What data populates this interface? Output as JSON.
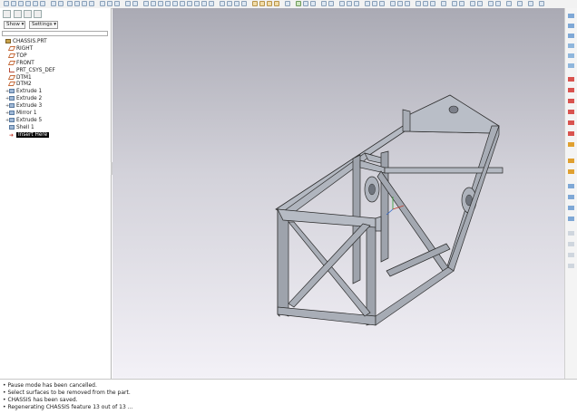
{
  "navigator": {
    "show_label": "Show ▾",
    "settings_label": "Settings ▾",
    "filter_value": "",
    "tree": [
      {
        "label": "CHASSIS.PRT",
        "icon": "part-icon",
        "expand": ""
      },
      {
        "label": "RIGHT",
        "icon": "datum-plane-icon",
        "expand": ""
      },
      {
        "label": "TOP",
        "icon": "datum-plane-icon",
        "expand": ""
      },
      {
        "label": "FRONT",
        "icon": "datum-plane-icon",
        "expand": ""
      },
      {
        "label": "PRT_CSYS_DEF",
        "icon": "csys-icon",
        "expand": ""
      },
      {
        "label": "DTM1",
        "icon": "datum-plane-icon",
        "expand": ""
      },
      {
        "label": "DTM2",
        "icon": "datum-plane-icon",
        "expand": ""
      },
      {
        "label": "Extrude 1",
        "icon": "extrude-icon",
        "expand": "+"
      },
      {
        "label": "Extrude 2",
        "icon": "extrude-icon",
        "expand": "+"
      },
      {
        "label": "Extrude 3",
        "icon": "extrude-icon",
        "expand": "+"
      },
      {
        "label": "Mirror 1",
        "icon": "mirror-icon",
        "expand": "+"
      },
      {
        "label": "Extrude 5",
        "icon": "extrude-icon",
        "expand": "+"
      },
      {
        "label": "Shell 1",
        "icon": "shell-icon",
        "expand": ""
      },
      {
        "label": "Insert Here",
        "icon": "insert-arrow-icon",
        "expand": ""
      }
    ]
  },
  "messages": [
    "• Pause mode has been cancelled.",
    "• Select surfaces to be removed from the part.",
    "• CHASSIS has been saved.",
    "• Regenerating CHASSIS feature 13 out of 13 ..."
  ],
  "colors": {
    "model_face": "#b4b9c2",
    "model_edge": "#2b2b2b",
    "canvas_top": "#aaaab4",
    "canvas_bottom": "#f3f1f7"
  }
}
